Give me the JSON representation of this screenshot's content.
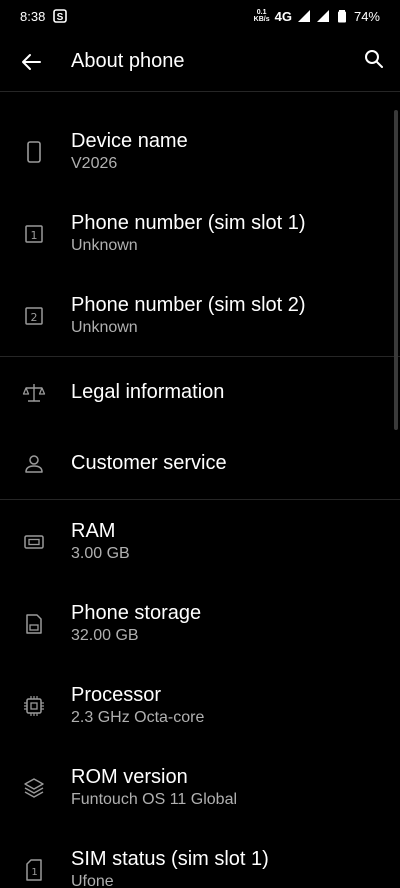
{
  "status_bar": {
    "time": "8:38",
    "speed_top": "0.1",
    "speed_bottom": "KB/s",
    "network": "4G",
    "battery": "74%"
  },
  "app_bar": {
    "title": "About phone"
  },
  "items": [
    {
      "icon": "phone-icon",
      "title": "Device name",
      "subtitle": "V2026"
    },
    {
      "icon": "sim-1-icon",
      "title": "Phone number (sim slot 1)",
      "subtitle": "Unknown"
    },
    {
      "icon": "sim-2-icon",
      "title": "Phone number (sim slot 2)",
      "subtitle": "Unknown"
    },
    {
      "icon": "scale-icon",
      "title": "Legal information"
    },
    {
      "icon": "person-icon",
      "title": "Customer service"
    },
    {
      "icon": "ram-icon",
      "title": "RAM",
      "subtitle": "3.00 GB"
    },
    {
      "icon": "storage-icon",
      "title": "Phone storage",
      "subtitle": "32.00 GB"
    },
    {
      "icon": "processor-icon",
      "title": "Processor",
      "subtitle": "2.3 GHz Octa-core"
    },
    {
      "icon": "layers-icon",
      "title": "ROM version",
      "subtitle": "Funtouch OS 11 Global"
    },
    {
      "icon": "sim-card-1-icon",
      "title": "SIM status (sim slot 1)",
      "subtitle": "Ufone"
    }
  ]
}
